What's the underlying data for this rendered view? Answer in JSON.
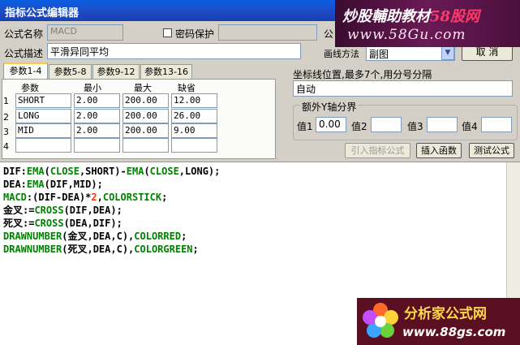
{
  "window": {
    "title": "指标公式编辑器"
  },
  "form": {
    "name_label": "公式名称",
    "name_value": "MACD",
    "password_label": "密码保护",
    "desc_label": "公式描述",
    "desc_value": "平滑异同平均",
    "draw_method_label": "画线方法",
    "draw_method_value": "副图",
    "partial_label": "公",
    "cancel_label": "取 消"
  },
  "tabs": [
    {
      "label": "参数1-4"
    },
    {
      "label": "参数5-8"
    },
    {
      "label": "参数9-12"
    },
    {
      "label": "参数13-16"
    }
  ],
  "params": {
    "headers": [
      "参数",
      "最小",
      "最大",
      "缺省"
    ],
    "rows": [
      {
        "num": "1",
        "name": "SHORT",
        "min": "2.00",
        "max": "200.00",
        "default": "12.00"
      },
      {
        "num": "2",
        "name": "LONG",
        "min": "2.00",
        "max": "200.00",
        "default": "26.00"
      },
      {
        "num": "3",
        "name": "MID",
        "min": "2.00",
        "max": "200.00",
        "default": "9.00"
      },
      {
        "num": "4",
        "name": "",
        "min": "",
        "max": "",
        "default": ""
      }
    ]
  },
  "axis": {
    "label": "坐标线位置,最多7个,用分号分隔",
    "value": "自动",
    "extra_y_label": "额外Y轴分界",
    "v1_label": "值1",
    "v1_value": "0.00",
    "v2_label": "值2",
    "v2_value": "",
    "v3_label": "值3",
    "v3_value": "",
    "v4_label": "值4",
    "v4_value": ""
  },
  "buttons": {
    "import": "引入指标公式",
    "insert": "插入函数",
    "test": "测试公式"
  },
  "code": {
    "l1": [
      "DIF:",
      "EMA",
      "(",
      "CLOSE",
      ",SHORT)-",
      "EMA",
      "(",
      "CLOSE",
      ",LONG);"
    ],
    "l2": [
      "DEA:",
      "EMA",
      "(DIF,MID);"
    ],
    "l3": [
      "MACD",
      ":(DIF-DEA)*",
      "2",
      ",",
      "COLORSTICK",
      ";"
    ],
    "l4": [
      "金叉:=",
      "CROSS",
      "(DIF,DEA);"
    ],
    "l5": [
      "死叉:=",
      "CROSS",
      "(DEA,DIF);"
    ],
    "l6": [
      "DRAWNUMBER",
      "(金叉,DEA,C),",
      "COLORRED",
      ";"
    ],
    "l7": [
      "DRAWNUMBER",
      "(死叉,DEA,C),",
      "COLORGREEN",
      ";"
    ]
  },
  "watermarks": {
    "top_a": "炒股輔助教材",
    "top_b": "58股网",
    "top_url": "www.58Gu.com",
    "bottom_name": "分析家公式网",
    "bottom_url": "www.88gs.com"
  },
  "colors": {
    "keyword_green": "#008000",
    "number_red": "#ff3300",
    "titlebar_blue": "#0a5fe0"
  }
}
